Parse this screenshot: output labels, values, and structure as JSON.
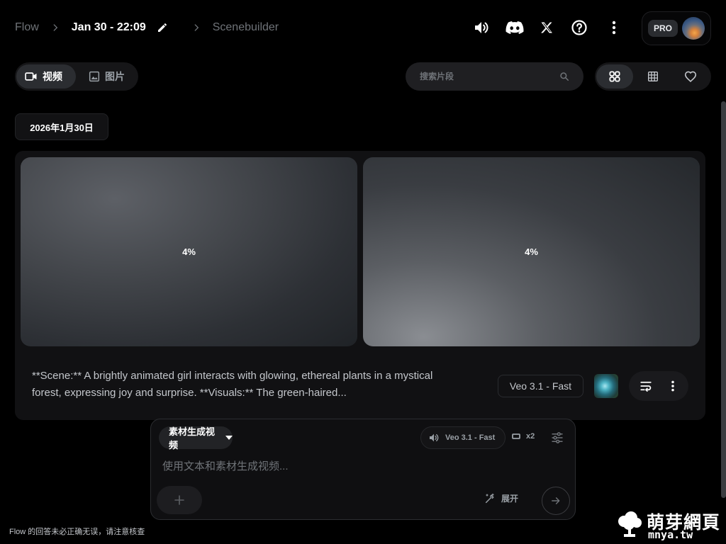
{
  "header": {
    "app_name": "Flow",
    "project_title": "Jan 30 - 22:09",
    "current_view": "Scenebuilder",
    "icons": [
      "volume-icon",
      "discord-icon",
      "x-logo-icon",
      "help-icon",
      "more-vert-icon"
    ],
    "plan_badge": "PRO"
  },
  "toolbar": {
    "tabs": [
      {
        "label": "视频",
        "icon": "videocam-icon",
        "active": true
      },
      {
        "label": "图片",
        "icon": "image-icon",
        "active": false
      }
    ],
    "search_placeholder": "搜索片段",
    "view_modes": [
      "grid-large-icon",
      "grid-small-icon",
      "favorite-icon"
    ]
  },
  "date_group": "2026年1月30日",
  "card": {
    "tiles": [
      {
        "progress_label": "4%",
        "progress": 0.04
      },
      {
        "progress_label": "4%",
        "progress": 0.04
      }
    ],
    "prompt": "**Scene:** A brightly animated girl interacts with glowing, ethereal plants in a mystical forest, expressing joy and surprise. **Visuals:** The green-haired...",
    "model": "Veo 3.1 - Fast"
  },
  "composer": {
    "mode": "素材生成视频",
    "model": "Veo 3.1 - Fast",
    "output_count": "x2",
    "placeholder": "使用文本和素材生成视频...",
    "expand_label": "展开"
  },
  "footer_note": "Flow 的回答未必正确无误，请注意核查",
  "watermark": {
    "name": "萌芽網頁",
    "url": "mnya.tw"
  },
  "colors": {
    "background": "#000000",
    "surface": "#111113",
    "chip": "#2b2d31",
    "text_primary": "#ffffff",
    "text_muted": "#6f7378"
  }
}
